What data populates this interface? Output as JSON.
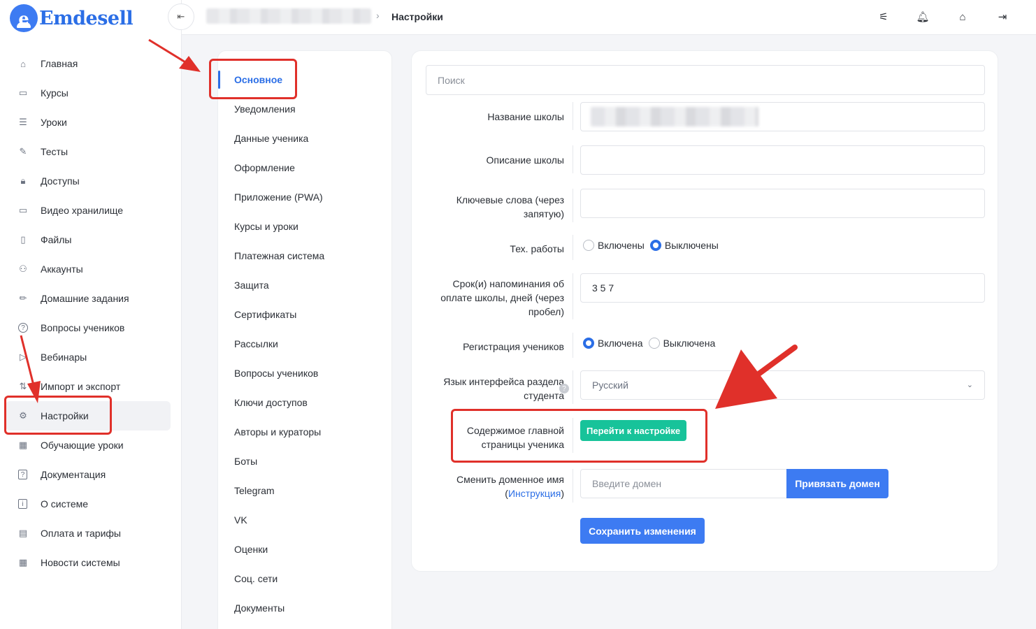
{
  "brand": {
    "name": "Emdesell",
    "logo_letter": "e",
    "accent": "#3d7bf2"
  },
  "sidebar": {
    "items": [
      {
        "label": "Главная",
        "icon": "home-icon",
        "glyph": "⌂"
      },
      {
        "label": "Курсы",
        "icon": "book-icon",
        "glyph": "▭"
      },
      {
        "label": "Уроки",
        "icon": "list-icon",
        "glyph": "☰"
      },
      {
        "label": "Тесты",
        "icon": "edit-icon",
        "glyph": "✎"
      },
      {
        "label": "Доступы",
        "icon": "lock-icon",
        "glyph": "🔒︎"
      },
      {
        "label": "Видео хранилище",
        "icon": "video-icon",
        "glyph": "▭"
      },
      {
        "label": "Файлы",
        "icon": "file-icon",
        "glyph": "▯"
      },
      {
        "label": "Аккаунты",
        "icon": "users-icon",
        "glyph": "⚇"
      },
      {
        "label": "Домашние задания",
        "icon": "pencil-icon",
        "glyph": "✏"
      },
      {
        "label": "Вопросы учеников",
        "icon": "question-icon",
        "glyph": "?"
      },
      {
        "label": "Вебинары",
        "icon": "play-icon",
        "glyph": "▷"
      },
      {
        "label": "Импорт и экспорт",
        "icon": "import-export-icon",
        "glyph": "⇅"
      },
      {
        "label": "Настройки",
        "icon": "gear-icon",
        "glyph": "⚙"
      },
      {
        "label": "Обучающие уроки",
        "icon": "film-icon",
        "glyph": "▦"
      },
      {
        "label": "Документация",
        "icon": "help-doc-icon",
        "glyph": "?"
      },
      {
        "label": "О системе",
        "icon": "info-icon",
        "glyph": "i"
      },
      {
        "label": "Оплата и тарифы",
        "icon": "receipt-icon",
        "glyph": "▤"
      },
      {
        "label": "Новости системы",
        "icon": "news-icon",
        "glyph": "▦"
      }
    ],
    "active_label": "Настройки"
  },
  "header": {
    "breadcrumb_current": "Настройки",
    "collapse_glyph": "⇤",
    "icons": [
      {
        "name": "filters-icon",
        "glyph": "⚟"
      },
      {
        "name": "bell-icon",
        "glyph": "🔔︎"
      },
      {
        "name": "home-settings-icon",
        "glyph": "⌂"
      },
      {
        "name": "logout-icon",
        "glyph": "⇥"
      }
    ]
  },
  "settings_menu": {
    "items": [
      "Основное",
      "Уведомления",
      "Данные ученика",
      "Оформление",
      "Приложение (PWA)",
      "Курсы и уроки",
      "Платежная система",
      "Защита",
      "Сертификаты",
      "Рассылки",
      "Вопросы учеников",
      "Ключи доступов",
      "Авторы и кураторы",
      "Боты",
      "Telegram",
      "VK",
      "Оценки",
      "Соц. сети",
      "Документы"
    ],
    "active": "Основное"
  },
  "form": {
    "search_placeholder": "Поиск",
    "school_name_label": "Название школы",
    "school_description_label": "Описание школы",
    "keywords_label_1": "Ключевые слова (через",
    "keywords_label_2": "запятую)",
    "maintenance_label": "Тех. работы",
    "maintenance_on": "Включены",
    "maintenance_off": "Выключены",
    "maintenance_value": "Выключены",
    "reminder_label_1": "Срок(и) напоминания об",
    "reminder_label_2": "оплате школы, дней (через",
    "reminder_label_3": "пробел)",
    "reminder_value": "3 5 7",
    "registration_label": "Регистрация учеников",
    "registration_on": "Включена",
    "registration_off": "Выключена",
    "registration_value": "Включена",
    "language_label_1": "Язык интерфейса раздела",
    "language_label_2": "студента",
    "language_value": "Русский",
    "homepage_label_1": "Содержимое главной",
    "homepage_label_2": "страницы ученика",
    "homepage_button": "Перейти к настройке",
    "domain_label_1": "Сменить доменное имя",
    "domain_label_paren_open": "(",
    "domain_label_link": "Инструкция",
    "domain_label_paren_close": ")",
    "domain_placeholder": "Введите домен",
    "bind_domain_button": "Привязать домен",
    "save_button": "Сохранить изменения"
  },
  "colors": {
    "primary": "#3d7bf2",
    "success": "#17c39a",
    "annotation": "#e0302a"
  }
}
